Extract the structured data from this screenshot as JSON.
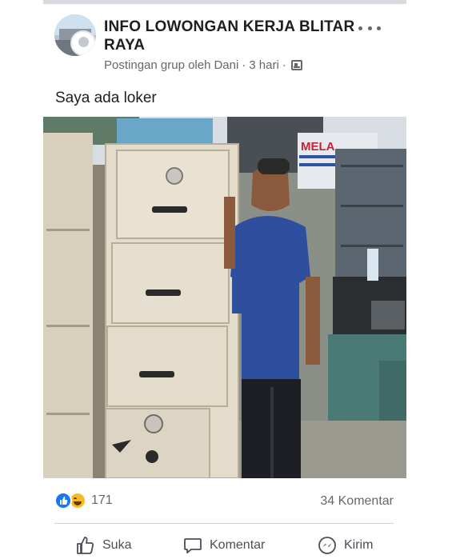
{
  "post": {
    "group_name": "INFO LOWONGAN KERJA BLITAR RAYA",
    "meta": {
      "type": "Postingan grup oleh",
      "author": "Dani",
      "separator": "·",
      "time": "3 hari"
    },
    "text": "Saya ada loker",
    "photo_signs": {
      "sign_top": "MELA"
    }
  },
  "engagement": {
    "reaction_count": "171",
    "comment_count": "34 Komentar"
  },
  "actions": {
    "like": "Suka",
    "comment": "Komentar",
    "share": "Kirim"
  },
  "icons": {
    "more": "more-horizontal-icon",
    "privacy": "group-privacy-icon",
    "like_reaction": "like-reaction-icon",
    "haha_reaction": "haha-reaction-icon",
    "like_action": "thumbs-up-icon",
    "comment_action": "comment-bubble-icon",
    "share_action": "messenger-icon"
  },
  "colors": {
    "brand_blue": "#1877f2",
    "haha_yellow": "#f7b928",
    "secondary_text": "#65676b"
  }
}
